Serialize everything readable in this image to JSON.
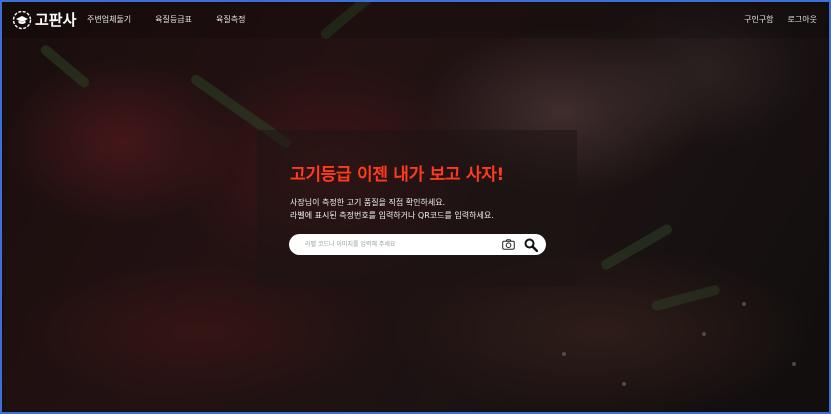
{
  "brand": {
    "logo_text": "고판사"
  },
  "nav": {
    "items": [
      {
        "label": "주변업체둘기"
      },
      {
        "label": "육질등급표"
      },
      {
        "label": "육질측정"
      }
    ]
  },
  "utility": {
    "items": [
      {
        "label": "구인구함"
      },
      {
        "label": "로그아웃"
      }
    ]
  },
  "hero": {
    "headline": "고기등급 이젠 내가 보고 사자!",
    "description_line1": "사장님이 측정한 고기 품질을 직접 확인하세요.",
    "description_line2": "라벨에 표시된 측정번호를 입력하거나 QR코드를 입력하세요."
  },
  "search": {
    "placeholder": "라벨 코드나 이미지를 입력해 주세요",
    "value": ""
  },
  "icons": {
    "logo": "graduation-cap-icon",
    "camera": "camera-icon",
    "search": "search-icon"
  },
  "colors": {
    "headline": "#ff3b1f",
    "frame_border": "#3d6fd6"
  }
}
